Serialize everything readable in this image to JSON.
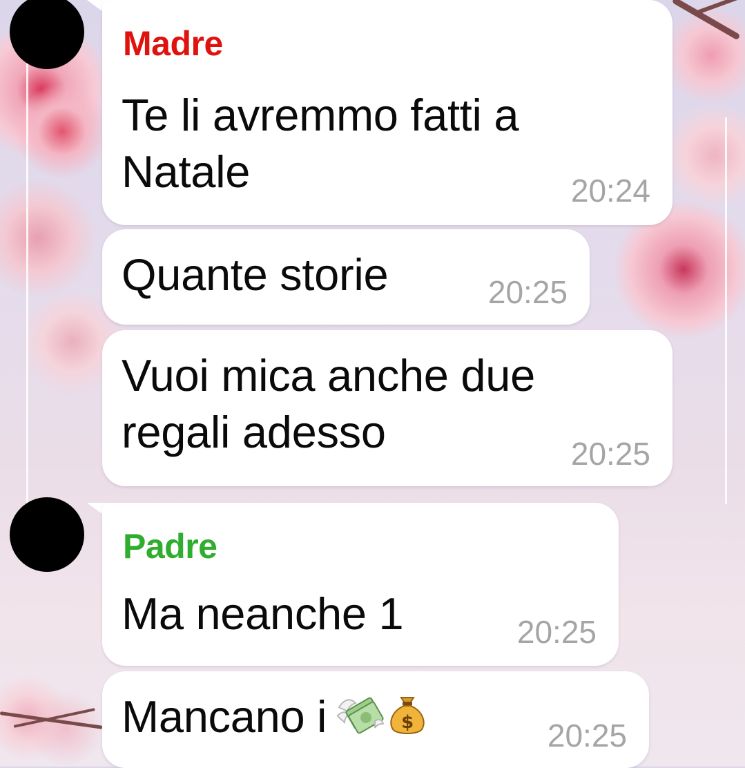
{
  "colors": {
    "madre_name": "#e0120e",
    "padre_name": "#2fad2e",
    "bubble_bg": "#ffffff",
    "time_text": "#a5a5a5"
  },
  "groups": [
    {
      "sender": "Madre",
      "messages": [
        {
          "text": "Te li avremmo fatti a\nNatale",
          "time": "20:24"
        },
        {
          "text": "Quante storie",
          "time": "20:25"
        },
        {
          "text": "Vuoi mica anche due\nregali adesso",
          "time": "20:25"
        }
      ]
    },
    {
      "sender": "Padre",
      "messages": [
        {
          "text": "Ma neanche 1",
          "time": "20:25"
        },
        {
          "text": "Mancano i",
          "time": "20:25",
          "emojis": [
            "money-with-wings-icon",
            "money-bag-icon"
          ]
        }
      ]
    }
  ]
}
